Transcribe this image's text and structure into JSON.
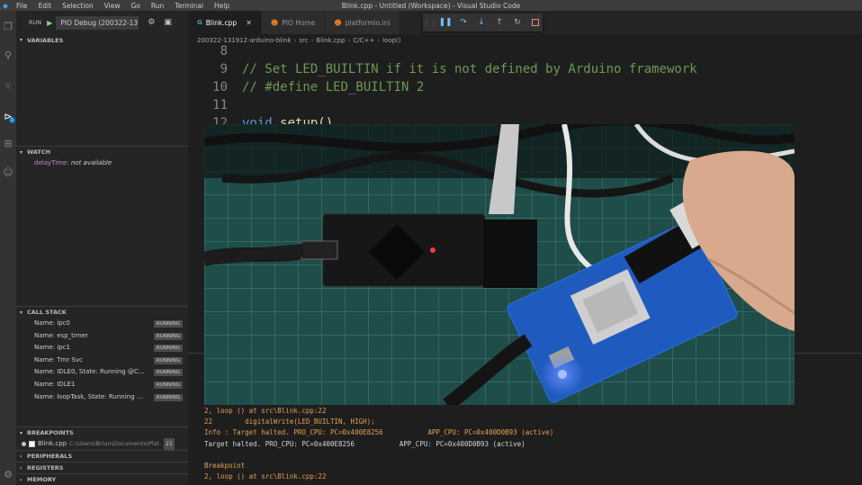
{
  "window": {
    "title": "Blink.cpp - Untitled (Workspace) - Visual Studio Code",
    "menu": [
      "File",
      "Edit",
      "Selection",
      "View",
      "Go",
      "Run",
      "Terminal",
      "Help"
    ]
  },
  "debug": {
    "run_label": "RUN",
    "config": "PIO Debug (200322-13"
  },
  "sidebar": {
    "variables_header": "VARIABLES",
    "watch_header": "WATCH",
    "watch": {
      "name": "delayTime:",
      "value": "not available"
    },
    "callstack_header": "CALL STACK",
    "callstack": [
      {
        "name": "Name: ipc0",
        "status": "RUNNING"
      },
      {
        "name": "Name: esp_timer",
        "status": "RUNNING"
      },
      {
        "name": "Name: ipc1",
        "status": "RUNNING"
      },
      {
        "name": "Name: Tmr Svc",
        "status": "RUNNING"
      },
      {
        "name": "Name: IDLE0, State: Running @C...",
        "status": "RUNNING"
      },
      {
        "name": "Name: IDLE1",
        "status": "RUNNING"
      },
      {
        "name": "Name: loopTask, State: Running ...",
        "status": "RUNNING"
      }
    ],
    "breakpoints_header": "BREAKPOINTS",
    "breakpoint": {
      "file": "Blink.cpp",
      "path": "C:\\Users\\Brian\\Documents\\Plat...",
      "line": "21"
    },
    "peripherals_header": "PERIPHERALS",
    "registers_header": "REGISTERS",
    "memory_header": "MEMORY"
  },
  "tabs": [
    {
      "label": "Blink.cpp",
      "icon": "c-icon",
      "active": true
    },
    {
      "label": "PIO Home",
      "icon": "pio-icon",
      "active": false
    },
    {
      "label": "platformio.ini",
      "icon": "pio-icon",
      "active": false
    }
  ],
  "breadcrumb": [
    "200322-131912-arduino-blink",
    "src",
    "Blink.cpp",
    "C/C++",
    "loop()"
  ],
  "code": [
    {
      "ln": "8",
      "text": "",
      "kind": "plain"
    },
    {
      "ln": "9",
      "text": "// Set LED_BUILTIN if it is not defined by Arduino framework",
      "kind": "comment"
    },
    {
      "ln": "10",
      "text": "// #define LED_BUILTIN 2",
      "kind": "comment"
    },
    {
      "ln": "11",
      "text": "",
      "kind": "plain"
    },
    {
      "ln": "12",
      "kw": "void",
      "fn": "setup()",
      "kind": "fn"
    }
  ],
  "output": [
    {
      "text": "2, loop () at src\\Blink.cpp:22",
      "color": "orange"
    },
    {
      "text": "22        digitalWrite(LED_BUILTIN, HIGH);",
      "color": "orange"
    },
    {
      "text": "Info : Target halted. PRO_CPU: PC=0x400E8256           APP_CPU: PC=0x400D0B93 (active)",
      "color": "orange"
    },
    {
      "text": "Target halted. PRO_CPU: PC=0x400E8256           APP_CPU: PC=0x400D0B93 (active)",
      "color": "white"
    },
    {
      "text": "",
      "color": "white"
    },
    {
      "text": "Breakpoint",
      "color": "orange"
    },
    {
      "text": "2, loop () at src\\Blink.cpp:22",
      "color": "orange"
    }
  ],
  "colors": {
    "accent": "#007acc",
    "debug_green": "#89d185",
    "stop_red": "#f48771",
    "output_orange": "#e5a050"
  }
}
